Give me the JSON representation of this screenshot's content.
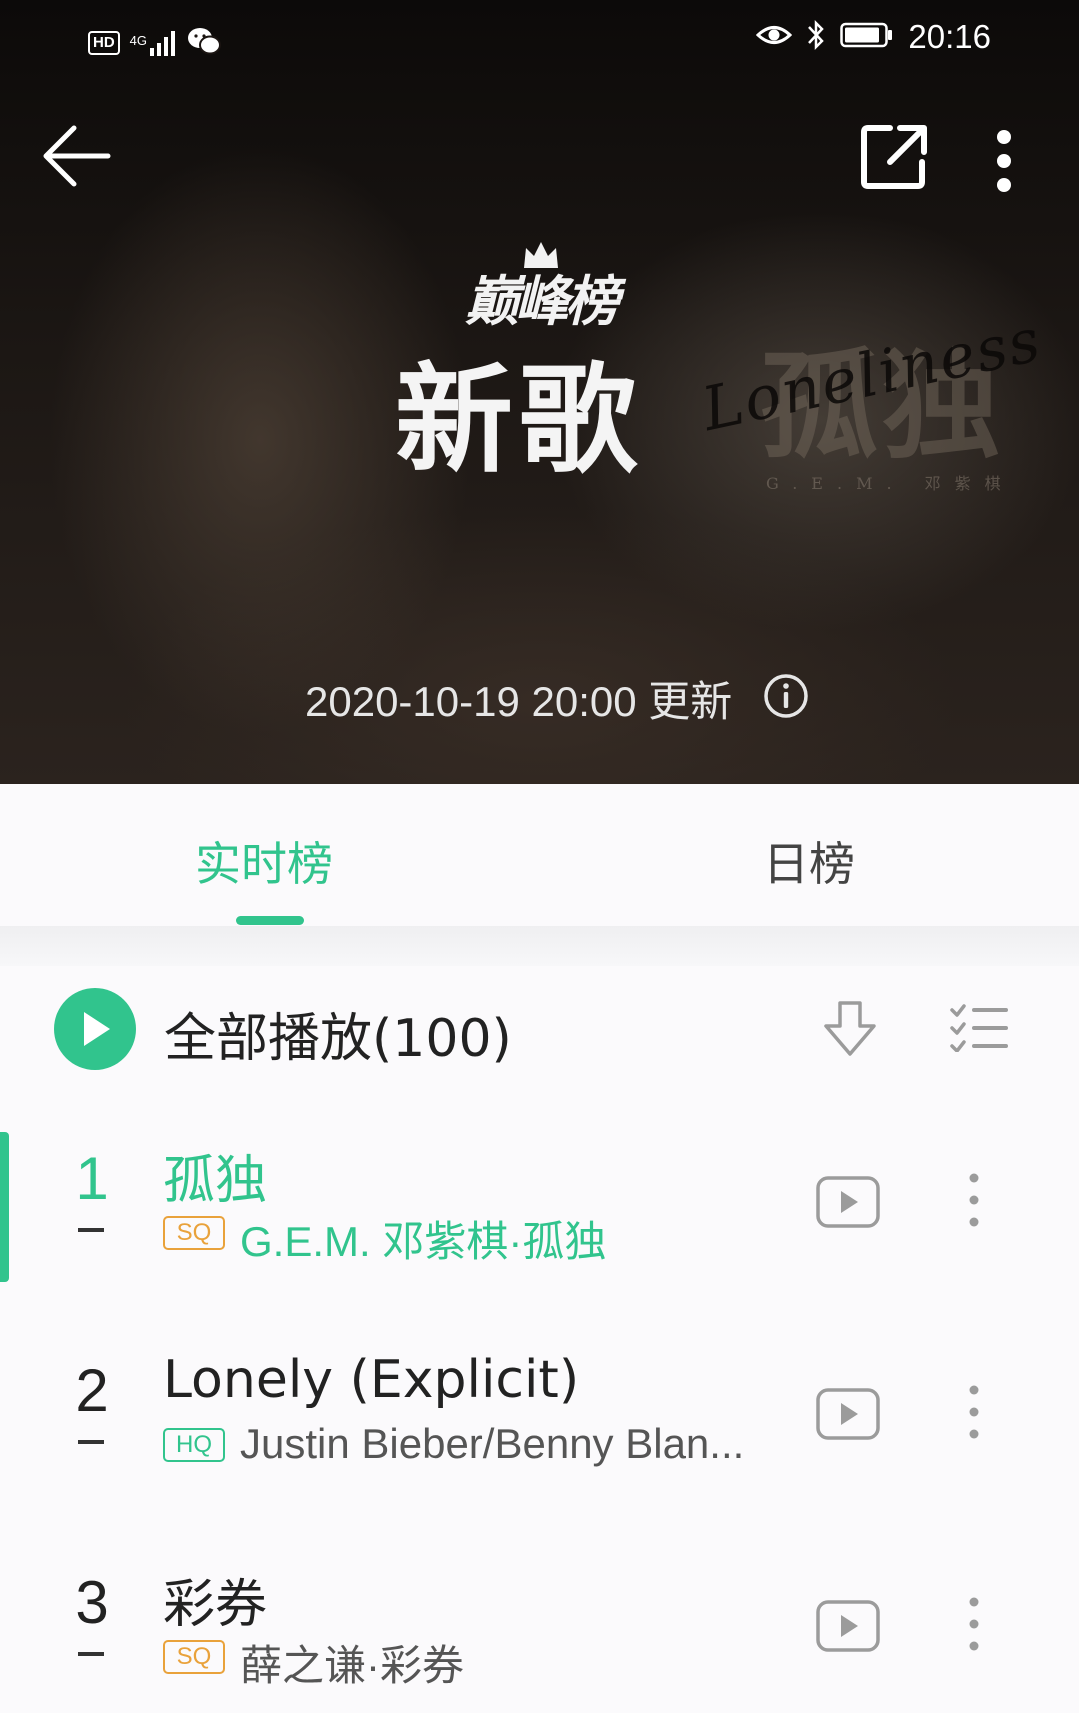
{
  "status_bar": {
    "hd_badge": "HD",
    "network": "4G",
    "time": "20:16"
  },
  "header": {
    "brand_logo_text": "巅峰榜",
    "title": "新歌",
    "album_art_chinese": "孤独",
    "album_art_script": "Loneliness",
    "album_art_credit": "G.E.M. 邓紫棋",
    "updated": "2020-10-19 20:00 更新"
  },
  "tabs": [
    {
      "label": "实时榜",
      "active": true
    },
    {
      "label": "日榜",
      "active": false
    }
  ],
  "play_all": {
    "label": "全部播放(100)"
  },
  "colors": {
    "accent": "#31c48d",
    "sq_badge": "#e9a23b",
    "hq_badge": "#31c48d"
  },
  "songs": [
    {
      "rank": "1",
      "title": "孤独",
      "quality": "SQ",
      "subtitle": "G.E.M. 邓紫棋·孤独",
      "active": true
    },
    {
      "rank": "2",
      "title": "Lonely (Explicit)",
      "quality": "HQ",
      "subtitle": "Justin Bieber/Benny Blan...",
      "active": false
    },
    {
      "rank": "3",
      "title": "彩券",
      "quality": "SQ",
      "subtitle": "薛之谦·彩券",
      "active": false
    }
  ]
}
